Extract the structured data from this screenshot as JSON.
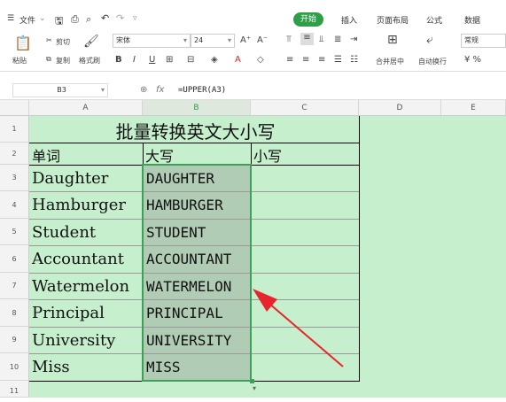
{
  "menubar": {
    "file": "文件",
    "tabs": [
      "开始",
      "插入",
      "页面布局",
      "公式",
      "数据"
    ]
  },
  "ribbon": {
    "cut": "剪切",
    "paste": "粘贴",
    "copy": "复制",
    "format_painter": "格式刷",
    "font_name": "宋体",
    "font_size": "24",
    "merge_center": "合并居中",
    "auto_wrap": "自动换行",
    "number_format": "常规"
  },
  "formulabar": {
    "name_box": "B3",
    "fx": "fx",
    "formula": "=UPPER(A3)"
  },
  "columns": [
    "A",
    "B",
    "C",
    "D",
    "E"
  ],
  "rows": [
    "1",
    "2",
    "3",
    "4",
    "5",
    "6",
    "7",
    "8",
    "9",
    "10",
    "11"
  ],
  "cells": {
    "title": "批量转换英文大小写",
    "header_a": "单词",
    "header_b": "大写",
    "header_c": "小写",
    "col_a": [
      "Daughter",
      "Hamburger",
      "Student",
      "Accountant",
      "Watermelon",
      "Principal",
      "University",
      "Miss"
    ],
    "col_b": [
      "DAUGHTER",
      "HAMBURGER",
      "STUDENT",
      "ACCOUNTANT",
      "WATERMELON",
      "PRINCIPAL",
      "UNIVERSITY",
      "MISS"
    ]
  },
  "colors": {
    "accent": "#2e9e48",
    "sheet_bg": "#c6efce",
    "selection": "#b0ccb4",
    "arrow": "#e8252b"
  }
}
